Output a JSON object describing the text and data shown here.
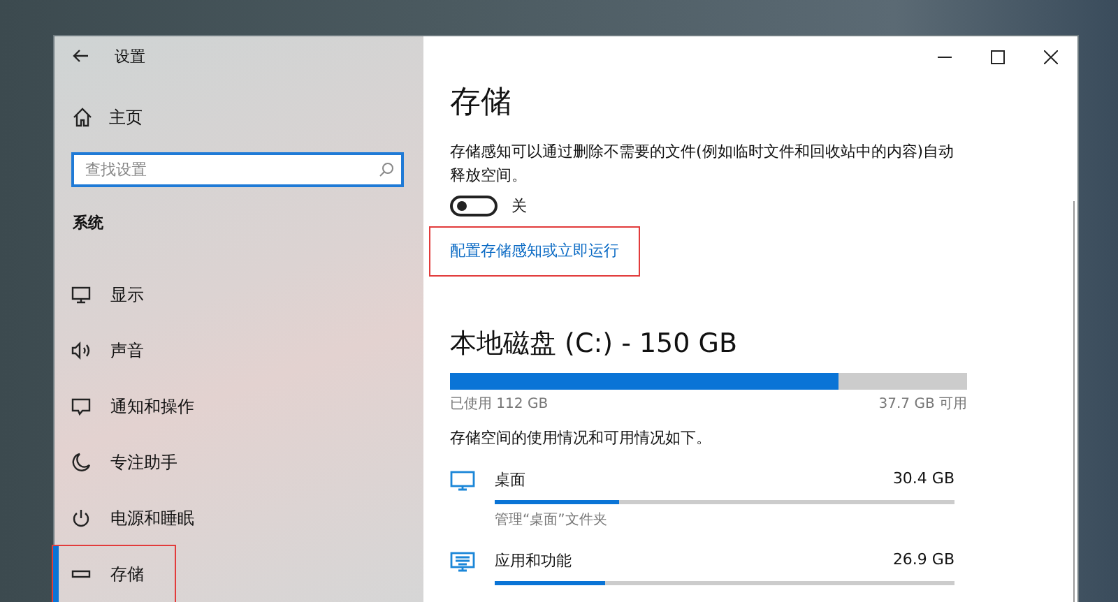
{
  "window": {
    "title": "设置"
  },
  "sidebar": {
    "home": "主页",
    "search": {
      "placeholder": "查找设置"
    },
    "section": "系统",
    "items": [
      {
        "label": "显示",
        "kind": "display",
        "selected": false,
        "highlighted": false
      },
      {
        "label": "声音",
        "kind": "sound",
        "selected": false,
        "highlighted": false
      },
      {
        "label": "通知和操作",
        "kind": "notify",
        "selected": false,
        "highlighted": false
      },
      {
        "label": "专注助手",
        "kind": "moon",
        "selected": false,
        "highlighted": false
      },
      {
        "label": "电源和睡眠",
        "kind": "power",
        "selected": false,
        "highlighted": false
      },
      {
        "label": "存储",
        "kind": "storage",
        "selected": true,
        "highlighted": true
      }
    ]
  },
  "content": {
    "title": "存储",
    "description": "存储感知可以通过删除不需要的文件(例如临时文件和回收站中的内容)自动释放空间。",
    "toggle": {
      "on": false,
      "label": "关"
    },
    "link": {
      "text": "配置存储感知或立即运行",
      "highlighted": true
    },
    "disk": {
      "title": "本地磁盘 (C:) - 150 GB",
      "level": 0.75,
      "used": "已使用 112 GB",
      "free": "37.7 GB 可用"
    },
    "usage_intro": "存储空间的使用情况和可用情况如下。",
    "categories": [
      {
        "name": "桌面",
        "kind": "monitor",
        "size": "30.4 GB",
        "level": 0.27,
        "detail": "管理“桌面”文件夹"
      },
      {
        "name": "应用和功能",
        "kind": "keyboard",
        "size": "26.9 GB",
        "level": 0.24
      }
    ]
  }
}
